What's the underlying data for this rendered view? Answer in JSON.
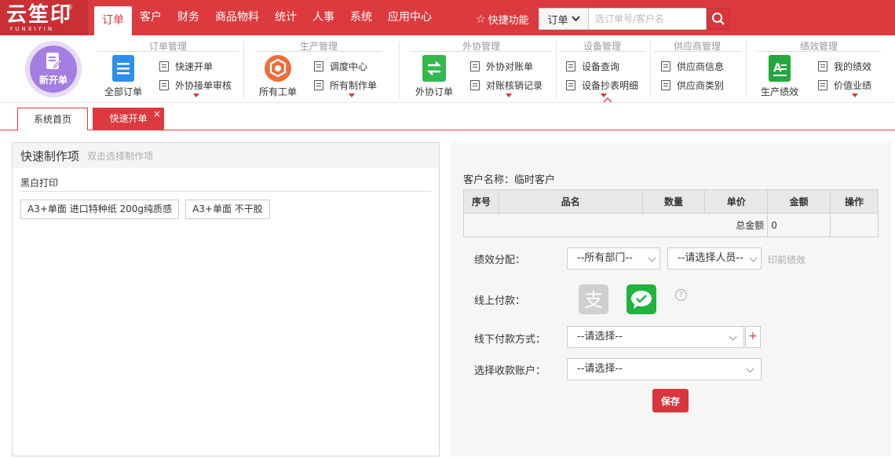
{
  "brand": {
    "name": "云笙印",
    "reg": "®",
    "sub": "YUNXIYIN"
  },
  "nav": [
    {
      "label": "订单",
      "active": true
    },
    {
      "label": "客户"
    },
    {
      "label": "财务"
    },
    {
      "label": "商品物料"
    },
    {
      "label": "统计"
    },
    {
      "label": "人事"
    },
    {
      "label": "系统"
    },
    {
      "label": "应用中心"
    }
  ],
  "quick_func": "快捷功能",
  "search": {
    "type": "订单",
    "placeholder": "选订单号/客户名"
  },
  "ribbon": {
    "new_order": "新开单",
    "groups": [
      {
        "title": "订单管理",
        "big": "全部订单",
        "items": [
          "快速开单",
          "外协接单审核"
        ]
      },
      {
        "title": "生产管理",
        "big": "所有工单",
        "items": [
          "调度中心",
          "所有制作单"
        ]
      },
      {
        "title": "外协管理",
        "big": "外协订单",
        "items": [
          "外协对账单",
          "对账核销记录"
        ]
      },
      {
        "title": "设备管理",
        "items": [
          "设备查询",
          "设备抄表明细"
        ]
      },
      {
        "title": "供应商管理",
        "items": [
          "供应商信息",
          "供应商类别"
        ]
      },
      {
        "title": "绩效管理",
        "big": "生产绩效",
        "items": [
          "我的绩效",
          "价值业绩"
        ]
      }
    ]
  },
  "tabs": {
    "home": "系统首页",
    "active": "快速开单",
    "close": "×"
  },
  "left": {
    "title": "快速制作项",
    "hint": "双击选择制作项",
    "section": "黑白打印",
    "items": [
      "A3+单面 进口特种纸 200g纯质感",
      "A3+单面 不干胶"
    ]
  },
  "right": {
    "customer": "客户名称：临时客户",
    "table": {
      "headers": [
        "序号",
        "品名",
        "数量",
        "单价",
        "金额",
        "操作"
      ],
      "total_label": "总金额",
      "total_value": "0"
    },
    "perf_label": "绩效分配：",
    "dept_select": "--所有部门--",
    "person_select": "--请选择人员--",
    "print_perf": "印前绩效",
    "online_label": "线上付款：",
    "help": "?",
    "offline_label": "线下付款方式：",
    "offline_select": "--请选择--",
    "plus": "+",
    "account_label": "选择收款账户：",
    "account_select": "--请选择--",
    "save": "保存"
  },
  "colors": {
    "brand_red": "#dd3a3f",
    "alipay_gray": "#cfcfcf",
    "wechat_green": "#22b33f"
  }
}
